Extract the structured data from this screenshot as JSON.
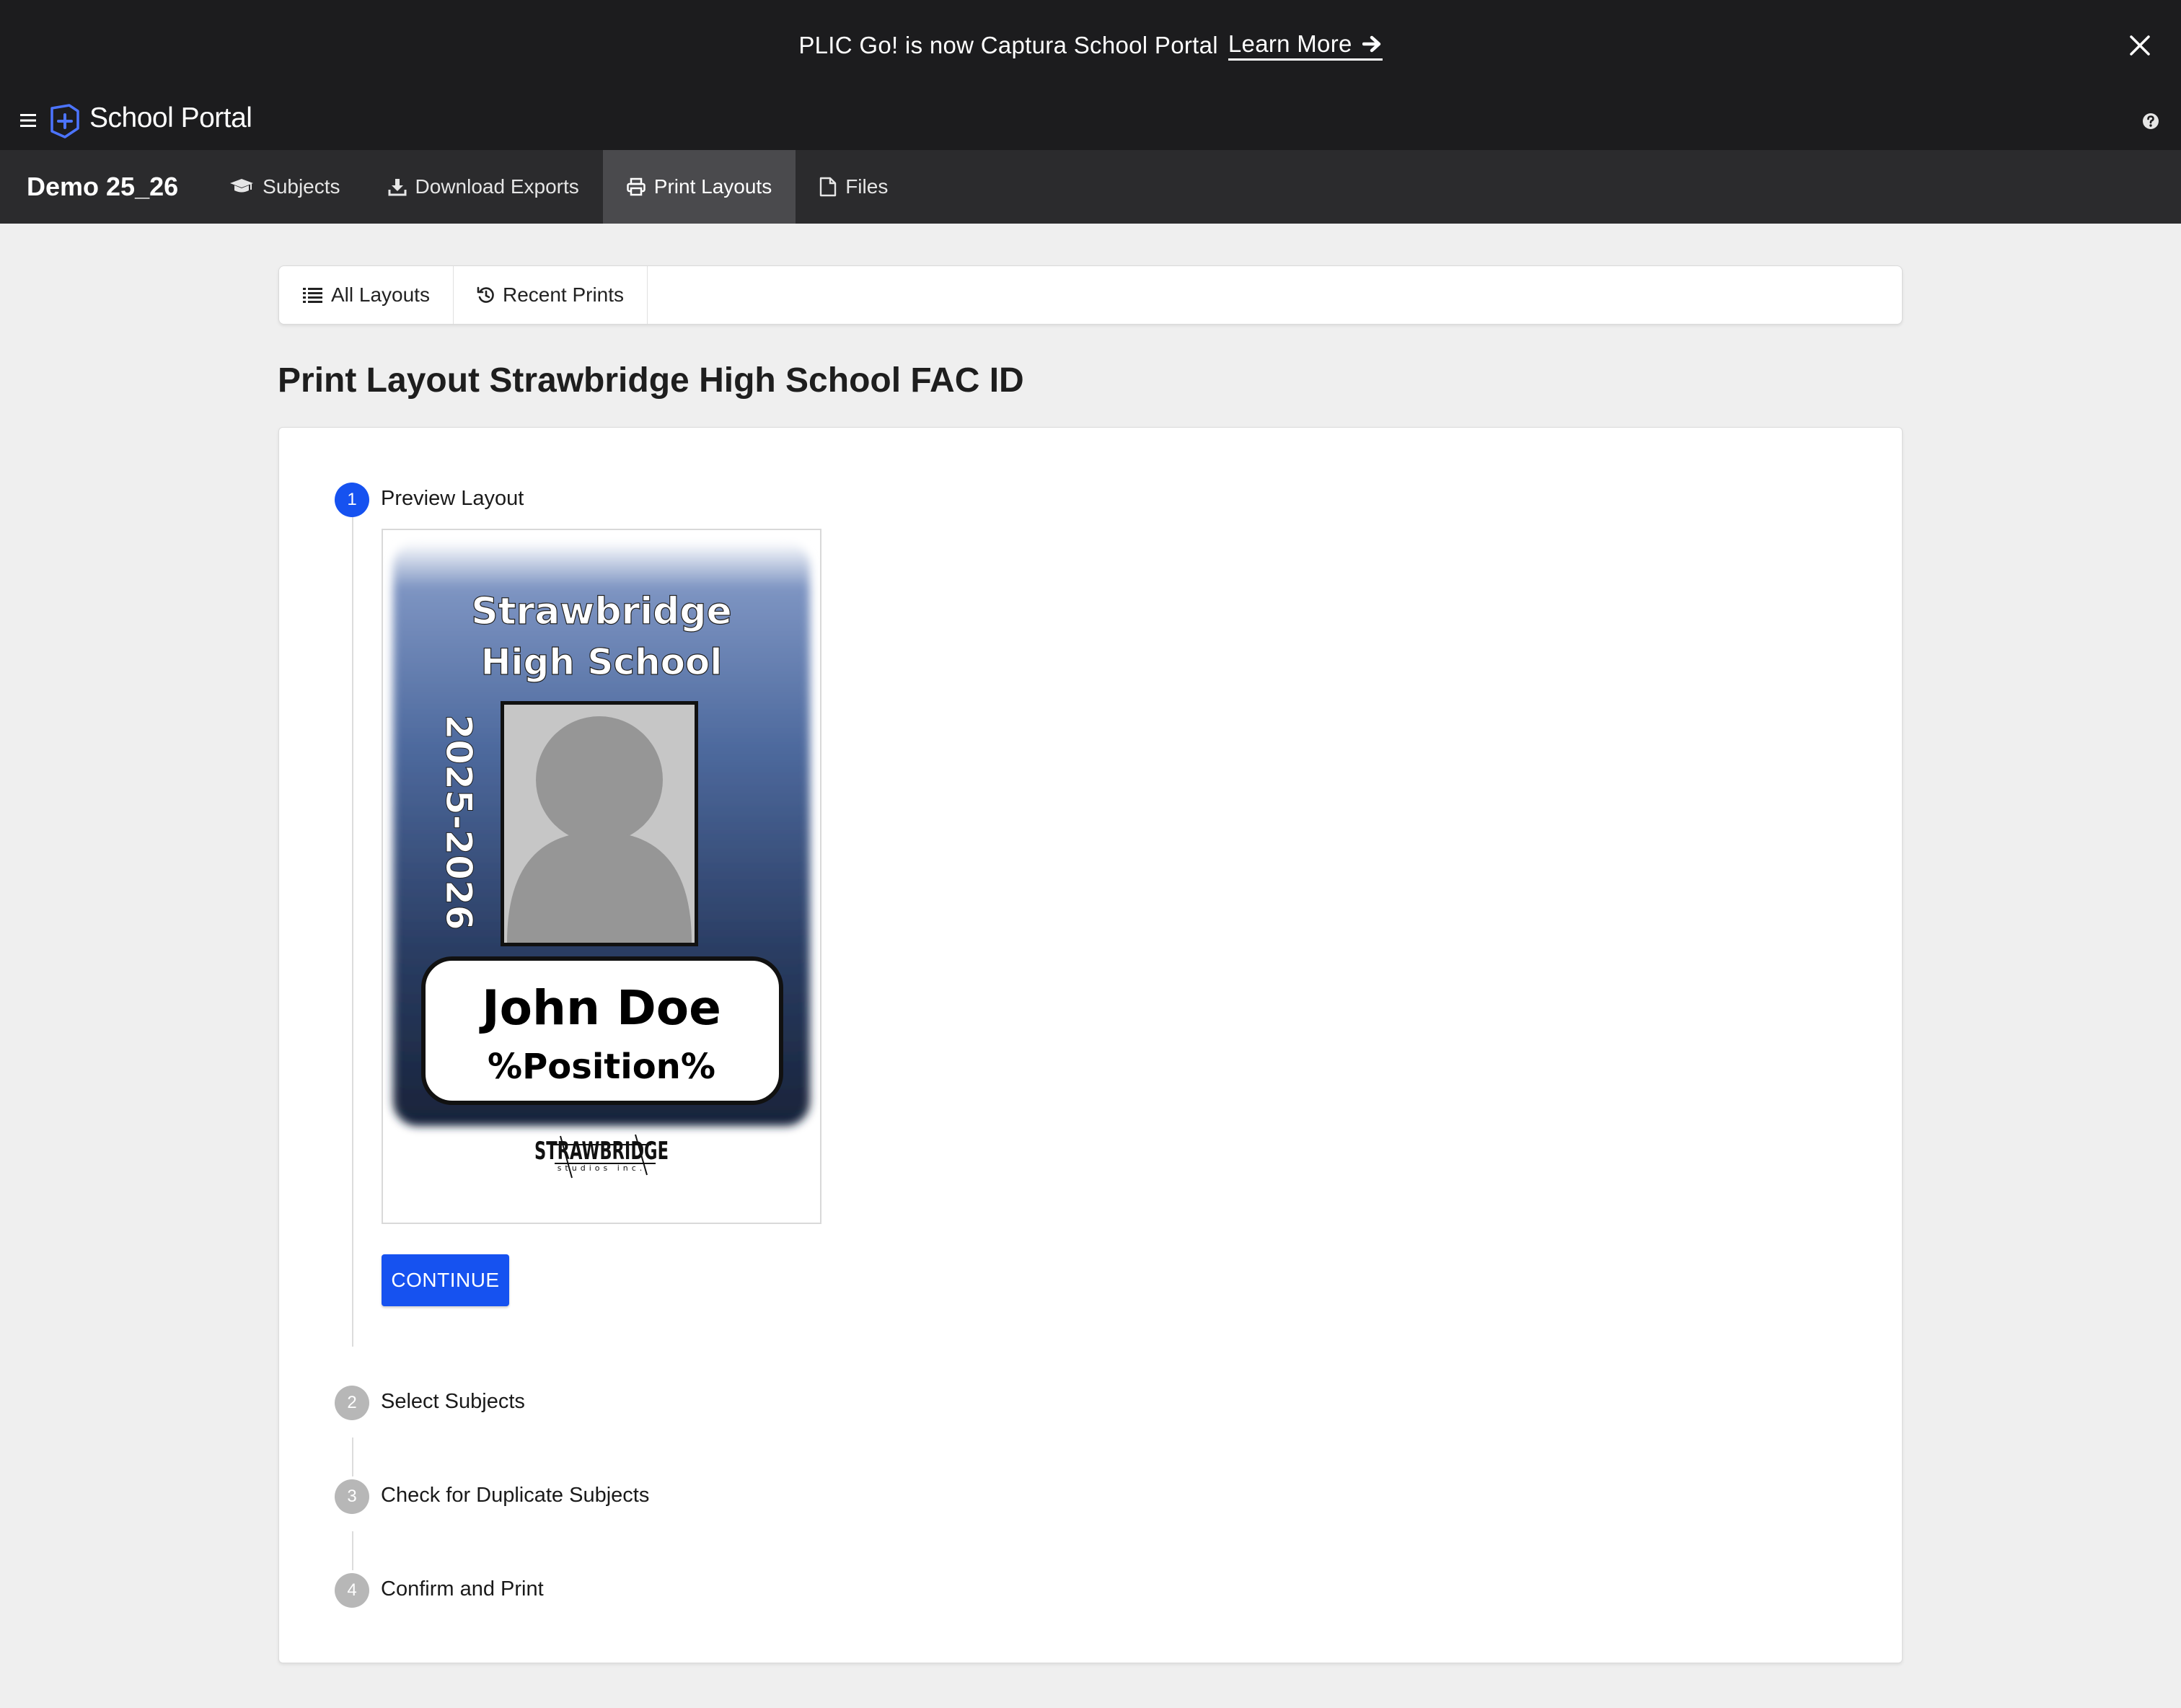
{
  "banner": {
    "message": "PLIC Go! is now Captura School Portal",
    "link_label": "Learn More"
  },
  "appbar": {
    "brand": "School Portal",
    "accent_color": "#4c74ff"
  },
  "subnav": {
    "project": "Demo 25_26",
    "tabs": [
      {
        "label": "Subjects",
        "icon": "graduation-cap-icon"
      },
      {
        "label": "Download Exports",
        "icon": "download-icon"
      },
      {
        "label": "Print Layouts",
        "icon": "printer-icon",
        "active": true
      },
      {
        "label": "Files",
        "icon": "file-icon"
      }
    ]
  },
  "toolbar": {
    "all_layouts": "All Layouts",
    "recent_prints": "Recent Prints"
  },
  "page": {
    "title": "Print Layout Strawbridge High School FAC ID"
  },
  "stepper": {
    "steps": [
      {
        "number": "1",
        "label": "Preview Layout",
        "active": true
      },
      {
        "number": "2",
        "label": "Select Subjects",
        "active": false
      },
      {
        "number": "3",
        "label": "Check for Duplicate Subjects",
        "active": false
      },
      {
        "number": "4",
        "label": "Confirm and Print",
        "active": false
      }
    ],
    "continue_label": "CONTINUE"
  },
  "id_card": {
    "school_line1": "Strawbridge",
    "school_line2": "High School",
    "year": "2025-2026",
    "name": "John Doe",
    "position": "%Position%",
    "studio_logo": "STRAWBRIDGE",
    "studio_sub": "studios inc.",
    "gradient_top": "#6f88b8",
    "gradient_bottom": "#1c2a44"
  },
  "colors": {
    "primary": "#1652f0",
    "dark_bar": "#1c1c1e",
    "subnav_bg": "#2b2b2d",
    "step_inactive": "#b7b7b7"
  }
}
